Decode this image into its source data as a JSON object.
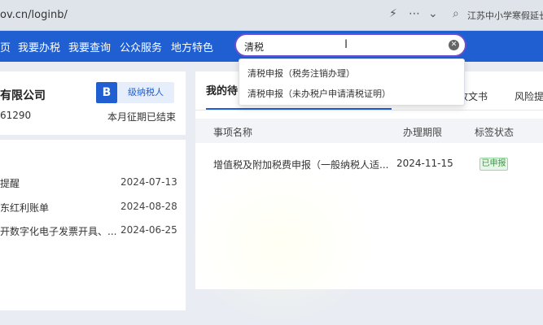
{
  "browser": {
    "url": "ov.cn/loginb/",
    "search_text": "江苏中小学寒假延长"
  },
  "nav": {
    "items": [
      "页",
      "我要办税",
      "我要查询",
      "公众服务",
      "地方特色"
    ],
    "search_value": "清税",
    "clear_icon": "clear-circle-icon"
  },
  "dropdown": {
    "items": [
      "清税申报（税务注销办理）",
      "清税申报（未办税户申请清税证明）"
    ]
  },
  "account": {
    "company_name": "有限公司",
    "tax_id": "61290",
    "badge_letter": "B",
    "level": "级纳税人",
    "period_status": "本月征期已结束"
  },
  "notices": [
    {
      "title": "提醒",
      "date": "2024-07-13"
    },
    {
      "title": "东红利账单",
      "date": "2024-08-28"
    },
    {
      "title": "开数字化电子发票开具、...",
      "date": "2024-06-25"
    }
  ],
  "tasks": {
    "title": "我的待",
    "tabs": [
      "收文书",
      "风险提"
    ],
    "columns": [
      "事项名称",
      "办理期限",
      "标签状态"
    ],
    "rows": [
      {
        "name": "增值税及附加税费申报（一般纳税人适...",
        "deadline": "2024-11-15",
        "status": "已申报"
      }
    ]
  }
}
